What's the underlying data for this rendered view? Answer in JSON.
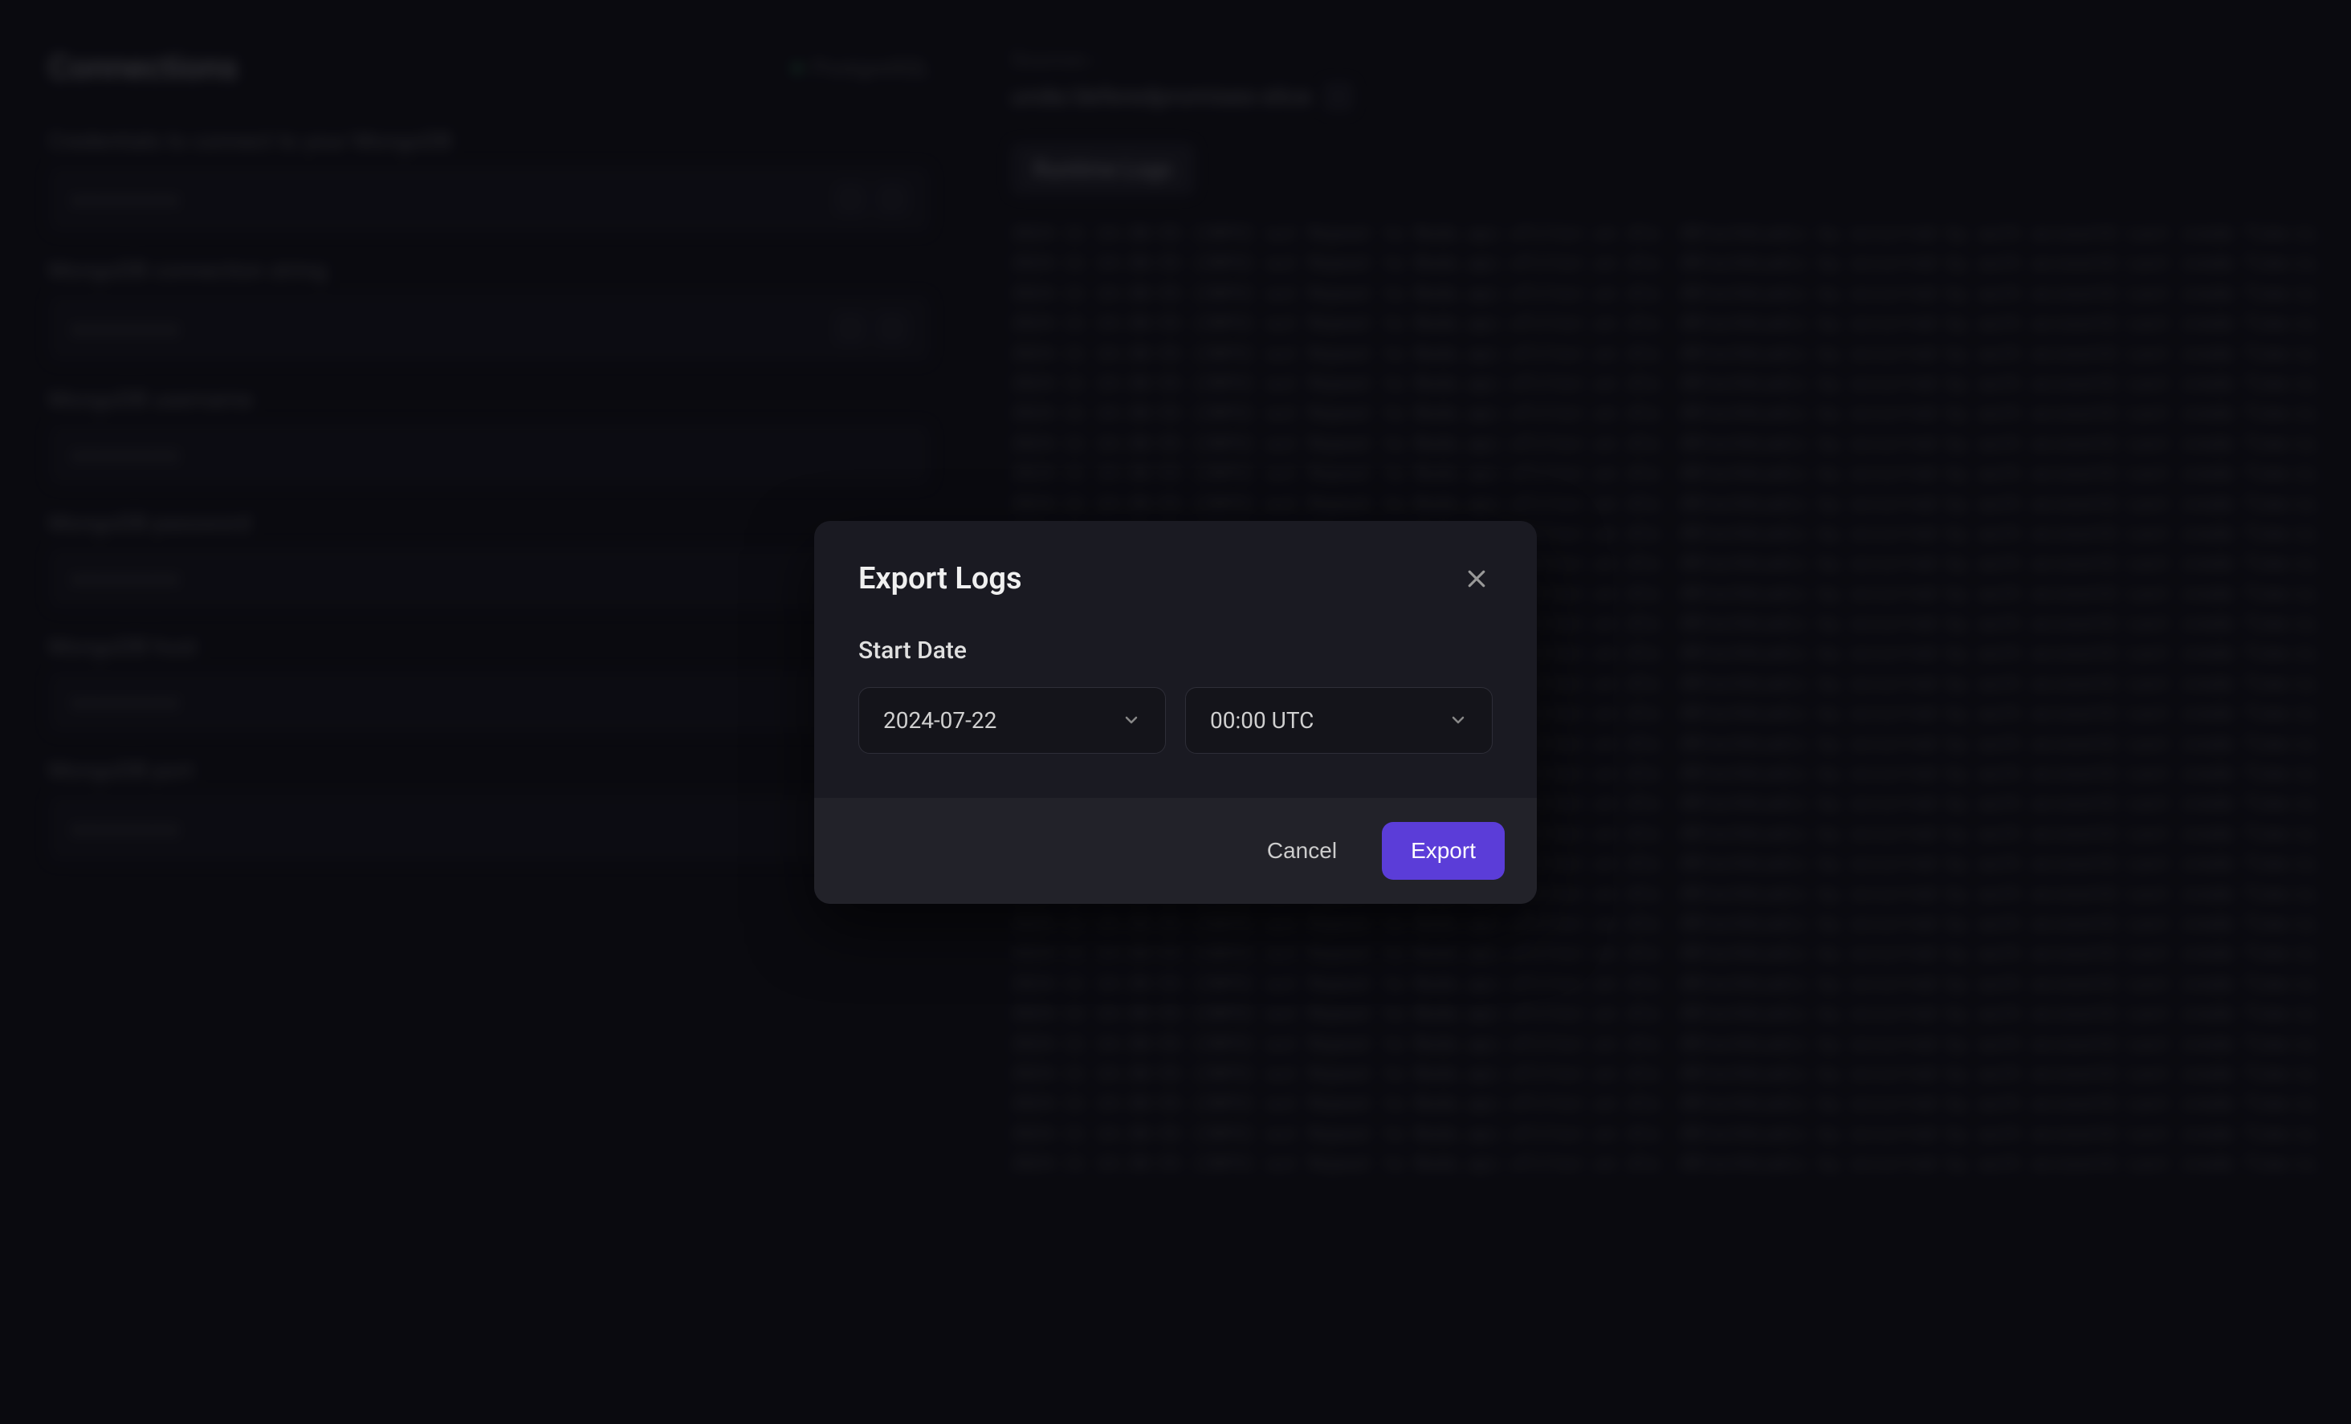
{
  "sidebar": {
    "title": "Connections",
    "db_badge": "PostgreSQL",
    "fields": [
      {
        "label": "Credentials to connect to your MongoDB"
      },
      {
        "label": "MongoDB connection string"
      },
      {
        "label": "MongoDB username"
      },
      {
        "label": "MongoDB password"
      },
      {
        "label": "MongoDB host"
      },
      {
        "label": "MongoDB port"
      }
    ],
    "placeholder_dots": "●●●●●●●●"
  },
  "main": {
    "breadcrumb": "Sources ›",
    "path": "unde/deferedpromises-slice",
    "tab_label": "Runtime Logs"
  },
  "logs_sample_prefix": "2024-11 14:30:55",
  "logs_sample_body": "[INFO] out Repeat to Node.api-xFilter.on dle .9DlechkLadic by occurred by auth accountG    Last inode     Time:LL",
  "modal": {
    "title": "Export Logs",
    "start_date_label": "Start Date",
    "date_value": "2024-07-22",
    "time_value": "00:00 UTC",
    "cancel_label": "Cancel",
    "export_label": "Export"
  }
}
